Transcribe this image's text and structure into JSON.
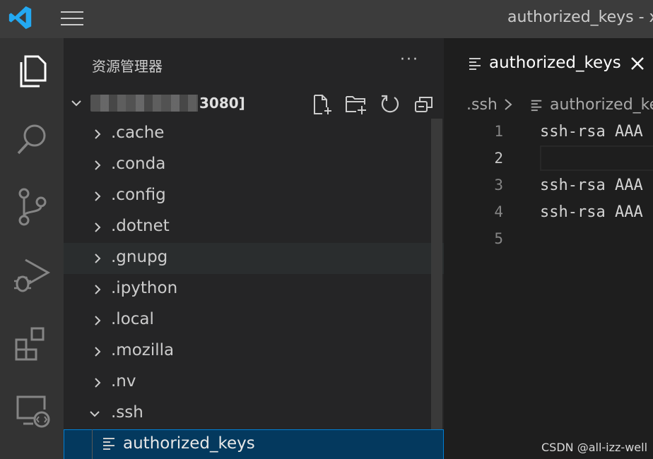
{
  "window": {
    "title": "authorized_keys - xt"
  },
  "activity": {
    "items": [
      {
        "name": "explorer-icon"
      },
      {
        "name": "search-icon"
      },
      {
        "name": "source-control-icon"
      },
      {
        "name": "run-debug-icon"
      },
      {
        "name": "extensions-icon"
      },
      {
        "name": "remote-explorer-icon"
      }
    ]
  },
  "sidebar": {
    "title": "资源管理器",
    "more": "···",
    "folder": {
      "suffix": "3080]"
    },
    "items": [
      {
        "label": ".cache"
      },
      {
        "label": ".conda"
      },
      {
        "label": ".config"
      },
      {
        "label": ".dotnet"
      },
      {
        "label": ".gnupg"
      },
      {
        "label": ".ipython"
      },
      {
        "label": ".local"
      },
      {
        "label": ".mozilla"
      },
      {
        "label": ".nv"
      },
      {
        "label": ".ssh"
      }
    ],
    "file": {
      "label": "authorized_keys"
    }
  },
  "editor": {
    "tab": {
      "label": "authorized_keys"
    },
    "breadcrumb": {
      "folder": ".ssh",
      "file": "authorized_keys"
    },
    "line_numbers": [
      "1",
      "2",
      "3",
      "4",
      "5"
    ],
    "lines": [
      "ssh-rsa AAA",
      "",
      "ssh-rsa AAA",
      "ssh-rsa AAA",
      ""
    ]
  },
  "watermark": "CSDN @all-izz-well",
  "colors": {
    "accent": "#007acc",
    "selection": "#04395e",
    "logo": "#23a9f2"
  }
}
